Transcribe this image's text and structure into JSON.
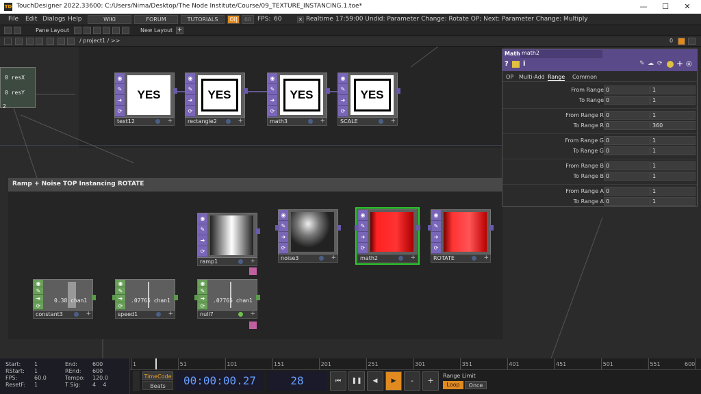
{
  "window": {
    "title": "TouchDesigner 2022.33600: C:/Users/Nima/Desktop/The Node Institute/Course/09_TEXTURE_INSTANCING.1.toe*",
    "minimize": "—",
    "maximize": "☐",
    "close": "✕"
  },
  "menu": {
    "items": [
      "File",
      "Edit",
      "Dialogs",
      "Help"
    ],
    "wiki": "WIKI",
    "forum": "FORUM",
    "tutorials": "TUTORIALS",
    "oi": "OI|",
    "fps_box": "60",
    "fps_label": "FPS:",
    "fps_value": "60",
    "realtime": "Realtime",
    "status": "17:59:00 Undid: Parameter Change: Rotate OP; Next: Parameter Change: Multiply"
  },
  "toolbar": {
    "pane_layout": "Pane Layout",
    "new_layout": "New Layout"
  },
  "path": {
    "text": "/ project1 / >>",
    "zero": "0"
  },
  "network": {
    "group_title": "Ramp + Noise TOP Instancing ROTATE",
    "left_partial": {
      "resx": "0 resX",
      "resy": "0 resY",
      "num": "2"
    },
    "nodes": [
      {
        "id": "text12",
        "label": "text12",
        "content": "YES"
      },
      {
        "id": "rectangle2",
        "label": "rectangle2",
        "content": "YES"
      },
      {
        "id": "math3",
        "label": "math3",
        "content": "YES"
      },
      {
        "id": "scale",
        "label": "SCALE",
        "content": "YES"
      },
      {
        "id": "ramp1",
        "label": "ramp1"
      },
      {
        "id": "noise3",
        "label": "noise3"
      },
      {
        "id": "math2",
        "label": "math2"
      },
      {
        "id": "rotate",
        "label": "ROTATE"
      },
      {
        "id": "constant3",
        "label": "constant3",
        "value": "0.38 chan1"
      },
      {
        "id": "speed1",
        "label": "speed1",
        "value": ".07765 chan1"
      },
      {
        "id": "null7",
        "label": "null7",
        "value": ".07765 chan1"
      }
    ]
  },
  "param": {
    "type": "Math",
    "name": "math2",
    "tabs": [
      "OP",
      "Multi-Add",
      "Range",
      "Common"
    ],
    "active_tab": "Range",
    "rows": [
      {
        "label": "From Range",
        "v1": "0",
        "v2": "1"
      },
      {
        "label": "To Range",
        "v1": "0",
        "v2": "1"
      },
      {
        "label": "From Range R",
        "v1": "0",
        "v2": "1"
      },
      {
        "label": "To Range R",
        "v1": "0",
        "v2": "360"
      },
      {
        "label": "From Range G",
        "v1": "0",
        "v2": "1"
      },
      {
        "label": "To Range G",
        "v1": "0",
        "v2": "1"
      },
      {
        "label": "From Range B",
        "v1": "0",
        "v2": "1"
      },
      {
        "label": "To Range B",
        "v1": "0",
        "v2": "1"
      },
      {
        "label": "From Range A",
        "v1": "0",
        "v2": "1"
      },
      {
        "label": "To Range A",
        "v1": "0",
        "v2": "1"
      }
    ]
  },
  "timeline": {
    "ruler_ticks": [
      "1",
      "51",
      "101",
      "151",
      "201",
      "251",
      "301",
      "351",
      "401",
      "451",
      "501",
      "551",
      "600"
    ],
    "start_label": "Start:",
    "start": "1",
    "rstart_label": "RStart:",
    "rstart": "1",
    "fps_label": "FPS:",
    "fps": "60.0",
    "resetf_label": "ResetF:",
    "resetf": "1",
    "end_label": "End:",
    "end": "600",
    "rend_label": "REnd:",
    "rend": "600",
    "tempo_label": "Tempo:",
    "tempo": "120.0",
    "tsig_label": "T Sig:",
    "tsig": "4    4",
    "timecode_btn": "TimeCode",
    "beats_btn": "Beats",
    "timecode": "00:00:00.27",
    "frame": "28",
    "range_limit": "Range Limit",
    "loop": "Loop",
    "once": "Once"
  }
}
